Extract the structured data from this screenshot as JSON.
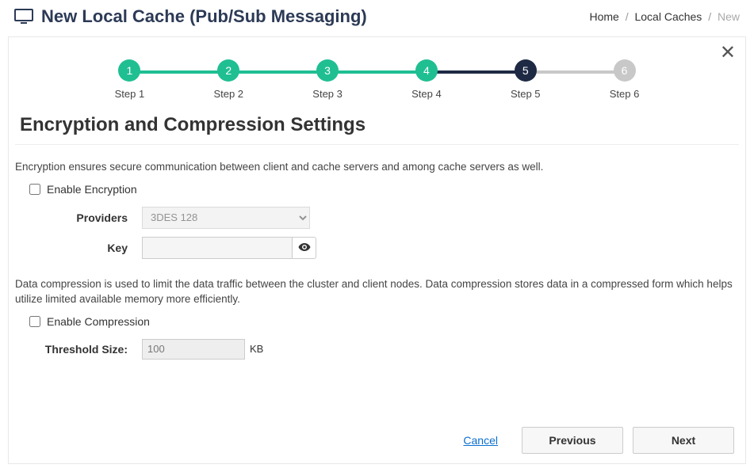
{
  "header": {
    "title": "New Local Cache (Pub/Sub Messaging)"
  },
  "breadcrumb": {
    "home": "Home",
    "caches": "Local Caches",
    "current": "New"
  },
  "stepper": [
    {
      "num": "1",
      "label": "Step 1",
      "state": "done"
    },
    {
      "num": "2",
      "label": "Step 2",
      "state": "done"
    },
    {
      "num": "3",
      "label": "Step 3",
      "state": "done"
    },
    {
      "num": "4",
      "label": "Step 4",
      "state": "done"
    },
    {
      "num": "5",
      "label": "Step 5",
      "state": "active"
    },
    {
      "num": "6",
      "label": "Step 6",
      "state": "upcoming"
    }
  ],
  "section": {
    "title": "Encryption and Compression Settings"
  },
  "encryption": {
    "desc": "Encryption ensures secure communication between client and cache servers and among cache servers as well.",
    "enable_label": "Enable Encryption",
    "providers_label": "Providers",
    "provider_selected": "3DES 128",
    "key_label": "Key",
    "key_value": ""
  },
  "compression": {
    "desc": "Data compression is used to limit the data traffic between the cluster and client nodes. Data compression stores data in a compressed form which helps utilize limited available memory more efficiently.",
    "enable_label": "Enable Compression",
    "threshold_label": "Threshold Size:",
    "threshold_value": "100",
    "threshold_unit": "KB"
  },
  "footer": {
    "cancel": "Cancel",
    "previous": "Previous",
    "next": "Next"
  },
  "colors": {
    "done": "#1fbf92",
    "active": "#1e2a44",
    "upcoming": "#c8c8c8"
  }
}
